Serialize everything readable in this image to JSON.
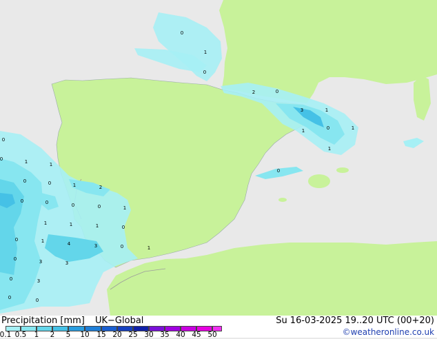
{
  "footer": {
    "title": "Precipitation [mm]",
    "model": "UK−Global",
    "datetime": "Su 16-03-2025 19..20 UTC (00+20)",
    "credit": "©weatheronline.co.uk"
  },
  "legend": {
    "ticks": [
      "0.1",
      "0.5",
      "1",
      "2",
      "5",
      "10",
      "15",
      "20",
      "25",
      "30",
      "35",
      "40",
      "45",
      "50"
    ],
    "colors": [
      "#a6f0f5",
      "#87e6f0",
      "#63d6ea",
      "#45c1e6",
      "#2a9ee0",
      "#1f7fd8",
      "#1a5fd0",
      "#1640c0",
      "#1020a8",
      "#7a10d8",
      "#a000e0",
      "#c800e0",
      "#e600e0",
      "#f030f0"
    ]
  },
  "map": {
    "colors": {
      "sea": "#e9e9e9",
      "land": "#c8f29a",
      "border": "#9c9c9c"
    },
    "value_labels": [
      "0",
      "1",
      "0",
      "2",
      "0",
      "3",
      "1",
      "1",
      "0",
      "1",
      "1",
      "0",
      "0",
      "1",
      "1",
      "0",
      "0",
      "0",
      "1",
      "2",
      "0",
      "0",
      "0",
      "0",
      "1",
      "1",
      "1",
      "1",
      "0",
      "0",
      "1",
      "4",
      "3",
      "0",
      "1",
      "0",
      "3",
      "3",
      "0",
      "3",
      "0",
      "0"
    ]
  }
}
